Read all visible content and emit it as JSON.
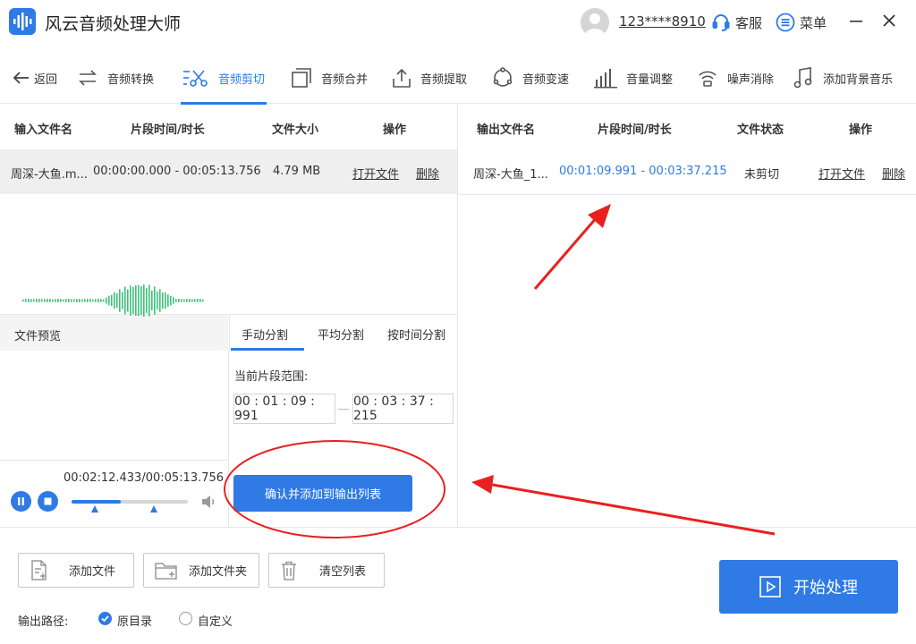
{
  "app": {
    "title": "风云音频处理大师",
    "user": "123****8910",
    "service_label": "客服",
    "menu_label": "菜单"
  },
  "nav": {
    "back": "返回",
    "items": [
      "音频转换",
      "音频剪切",
      "音频合并",
      "音频提取",
      "音频变速",
      "音量调整",
      "噪声消除",
      "添加背景音乐"
    ],
    "active": "音频剪切"
  },
  "input_table": {
    "headers": [
      "输入文件名",
      "片段时间/时长",
      "文件大小",
      "操作"
    ],
    "rows": [
      {
        "name": "周深-大鱼.m...",
        "duration": "00:00:00.000 - 00:05:13.756",
        "size": "4.79 MB",
        "open": "打开文件",
        "delete": "删除"
      }
    ]
  },
  "output_table": {
    "headers": [
      "输出文件名",
      "片段时间/时长",
      "文件状态",
      "操作"
    ],
    "rows": [
      {
        "name": "周深-大鱼_1...",
        "range": "00:01:09.991 - 00:03:37.215",
        "status": "未剪切",
        "open": "打开文件",
        "delete": "删除"
      }
    ]
  },
  "preview": {
    "label": "文件预览",
    "time_readout": "00:02:12.433/00:05:13.756",
    "progress": 0.42
  },
  "split": {
    "tabs": [
      "手动分割",
      "平均分割",
      "按时间分割"
    ],
    "active_tab": "手动分割",
    "range_label": "当前片段范围:",
    "start": "00 : 01 : 09 : 991",
    "end": "00 : 03 : 37 : 215",
    "confirm": "确认并添加到输出列表"
  },
  "bottom": {
    "add_file": "添加文件",
    "add_folder": "添加文件夹",
    "clear_list": "清空列表",
    "output_path_label": "输出路径:",
    "option_original": "原目录",
    "option_custom": "自定义",
    "start": "开始处理"
  },
  "colors": {
    "accent": "#2f7ae5",
    "wave_green": "#3cc27a",
    "annotation_red": "#e8211f"
  }
}
